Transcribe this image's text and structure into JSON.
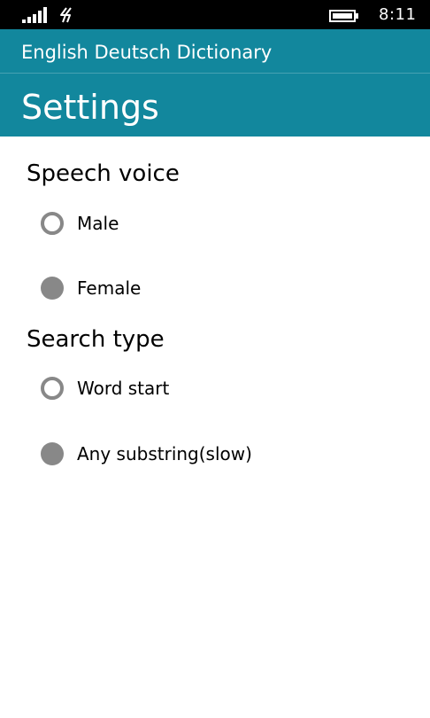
{
  "status_bar": {
    "time": "8:11",
    "icons": [
      "signal-strength-icon",
      "data-connection-icon",
      "battery-icon"
    ]
  },
  "header": {
    "app_title": "English Deutsch Dictionary",
    "page_title": "Settings"
  },
  "colors": {
    "accent": "#12879d",
    "status_bar": "#000000",
    "radio": "#888888"
  },
  "sections": [
    {
      "title": "Speech voice",
      "options": [
        {
          "label": "Male",
          "selected": false
        },
        {
          "label": "Female",
          "selected": true
        }
      ]
    },
    {
      "title": "Search type",
      "options": [
        {
          "label": "Word start",
          "selected": false
        },
        {
          "label": "Any substring(slow)",
          "selected": true
        }
      ]
    }
  ]
}
